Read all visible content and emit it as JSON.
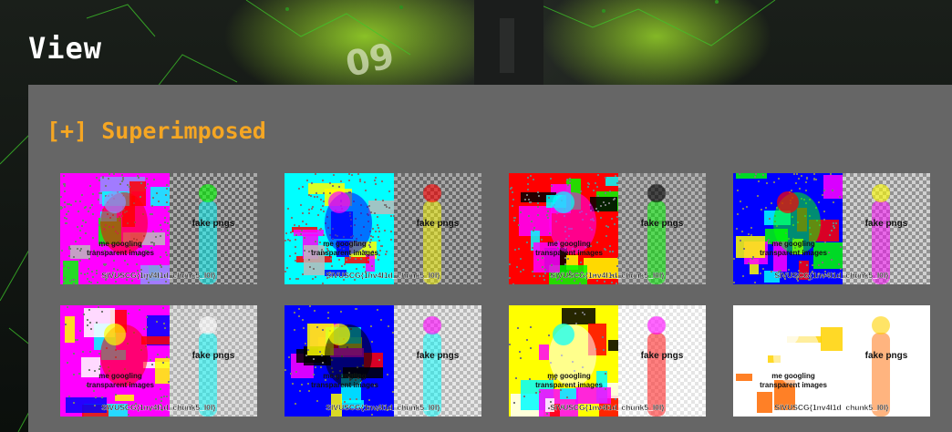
{
  "page": {
    "title": "View"
  },
  "section": {
    "title": "[+] Superimposed"
  },
  "images": [
    {
      "label_top": "fake pngs",
      "label_mid1": "me googling",
      "label_mid2": "transparent images",
      "footer": "SIVUSCG{1nv4l1d_chunk5_l0l}",
      "palette": [
        "#ff00ff",
        "#00ff00",
        "#00ffff",
        "#ff0000",
        "#9090ff",
        "#bbbbbb"
      ],
      "right_bg": "#aaaaaa",
      "noise": 0.8
    },
    {
      "label_top": "fake pngs",
      "label_mid1": "me googling",
      "label_mid2": "transparent images",
      "footer": "SIVUSCG{1nv4l1d_chunk5_l0l}",
      "palette": [
        "#00ffff",
        "#ff0000",
        "#ffff00",
        "#0000ff",
        "#ff00ff",
        "#bbbbbb"
      ],
      "right_bg": "#a8a8a8",
      "noise": 0.75
    },
    {
      "label_top": "fake pngs",
      "label_mid1": "me googling",
      "label_mid2": "transparent images",
      "footer": "SIVUSCG{1nv4l1d_chunk5_l0l}",
      "palette": [
        "#ff0000",
        "#000000",
        "#00ff00",
        "#ff00ff",
        "#00ffff",
        "#ffff00"
      ],
      "right_bg": "#b0b0b0",
      "noise": 0.6
    },
    {
      "label_top": "fake pngs",
      "label_mid1": "me googling",
      "label_mid2": "transparent images",
      "footer": "SIVUSCG{1nv4l1d_chunk5_l0l}",
      "palette": [
        "#0000ff",
        "#ffff00",
        "#ff00ff",
        "#00ff00",
        "#ff0000",
        "#00ffff"
      ],
      "right_bg": "#d0d0d0",
      "noise": 0.5
    },
    {
      "label_top": "fake pngs",
      "label_mid1": "me googling",
      "label_mid2": "transparent images",
      "footer": "SIVUSCG{1nv4l1d_chunk5_l0l}",
      "palette": [
        "#ff00ff",
        "#ffffff",
        "#00ffff",
        "#ff0000",
        "#ffff00",
        "#0000ff"
      ],
      "right_bg": "#dddddd",
      "noise": 0.3
    },
    {
      "label_top": "fake pngs",
      "label_mid1": "me googling",
      "label_mid2": "transparent images",
      "footer": "SIVUSCG{1nv4l1d_chunk5_l0l}",
      "palette": [
        "#0000ff",
        "#ff00ff",
        "#00ffff",
        "#000000",
        "#ffff00",
        "#ff0000"
      ],
      "right_bg": "#e6e6e6",
      "noise": 0.3
    },
    {
      "label_top": "fake pngs",
      "label_mid1": "me googling",
      "label_mid2": "transparent images",
      "footer": "SIVUSCG{1nv4l1d_chunk5_l0l}",
      "palette": [
        "#ffff00",
        "#ff00ff",
        "#ff0000",
        "#ffffff",
        "#00ffff",
        "#000000"
      ],
      "right_bg": "#ffffff",
      "noise": 0.15
    },
    {
      "label_top": "fake pngs",
      "label_mid1": "me googling",
      "label_mid2": "transparent images",
      "footer": "SIVUSCG{1nv4l1d_chunk5_l0l}",
      "palette": [
        "#ffffff",
        "#ffd200",
        "#ff6a00",
        "#ffffff",
        "#ffffff",
        "#ffffff"
      ],
      "right_bg": "#ffffff",
      "noise": 0.0
    }
  ]
}
